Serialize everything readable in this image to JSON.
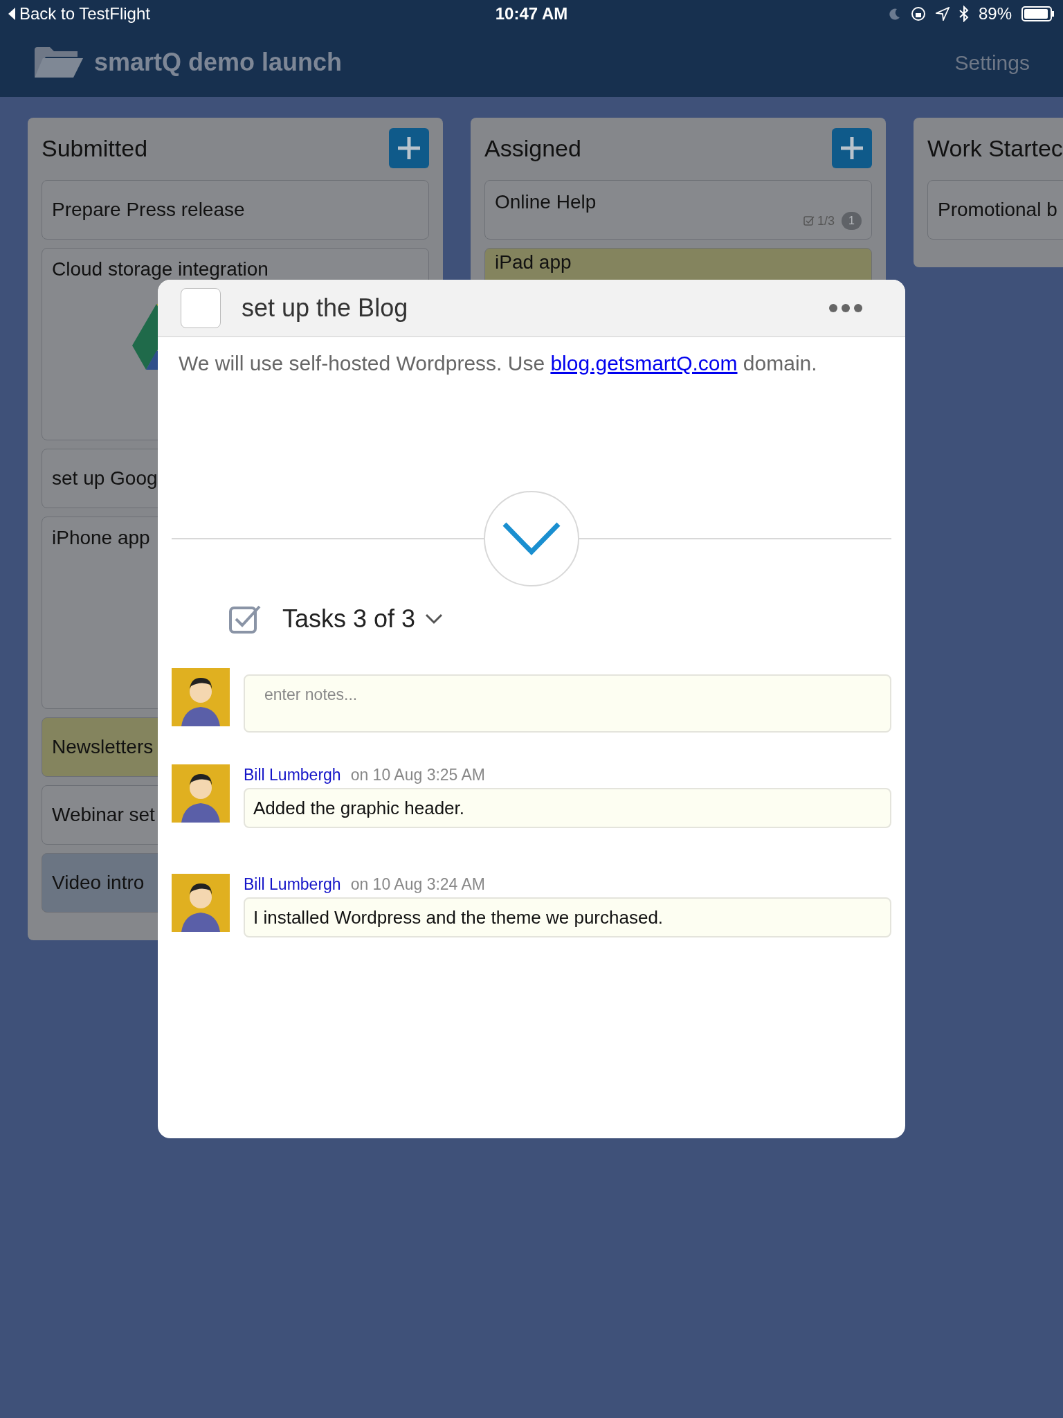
{
  "status_bar": {
    "back": "Back to TestFlight",
    "time": "10:47 AM",
    "battery": "89%"
  },
  "nav": {
    "title": "smartQ demo launch",
    "settings": "Settings"
  },
  "columns": [
    {
      "title": "Submitted",
      "add_button": true,
      "cards": [
        {
          "kind": "text",
          "title": "Prepare Press release",
          "color": "#87898d"
        },
        {
          "kind": "image",
          "title": "Cloud storage integration",
          "color": "#87898d"
        },
        {
          "kind": "text",
          "title": "set up Goog",
          "color": "#87898d"
        },
        {
          "kind": "tall",
          "title": "iPhone app",
          "color": "#87898d"
        },
        {
          "kind": "text",
          "title": "Newsletters",
          "color": "#84845e"
        },
        {
          "kind": "text",
          "title": "Webinar set",
          "color": "#87898d"
        },
        {
          "kind": "text",
          "title": "Video intro",
          "color": "#6b7583"
        }
      ]
    },
    {
      "title": "Assigned",
      "add_button": true,
      "cards": [
        {
          "kind": "text",
          "title": "Online  Help",
          "color": "#87898d",
          "tasks": "1/3",
          "comments": "1"
        },
        {
          "kind": "peek",
          "title": "iPad app",
          "color": "#84845e"
        }
      ]
    },
    {
      "title": "Work Startec",
      "add_button": false,
      "cards": [
        {
          "kind": "text",
          "title": "Promotional b",
          "color": "#87898d"
        }
      ]
    }
  ],
  "task": {
    "title": "set up the Blog",
    "checked": false,
    "description": {
      "before": "We will use self-hosted Wordpress. Use ",
      "link": "blog.getsmartQ.com",
      "after": " domain."
    },
    "tasks": "Tasks 3 of 3",
    "notes_placeholder": "enter notes...",
    "comments": [
      {
        "author": "Bill Lumbergh",
        "time": "on 10 Aug 3:25 AM",
        "text": "Added the graphic header."
      },
      {
        "author": "Bill Lumbergh",
        "time": "on 10 Aug 3:24 AM",
        "text": "I installed Wordpress and the theme we purchased."
      }
    ]
  }
}
